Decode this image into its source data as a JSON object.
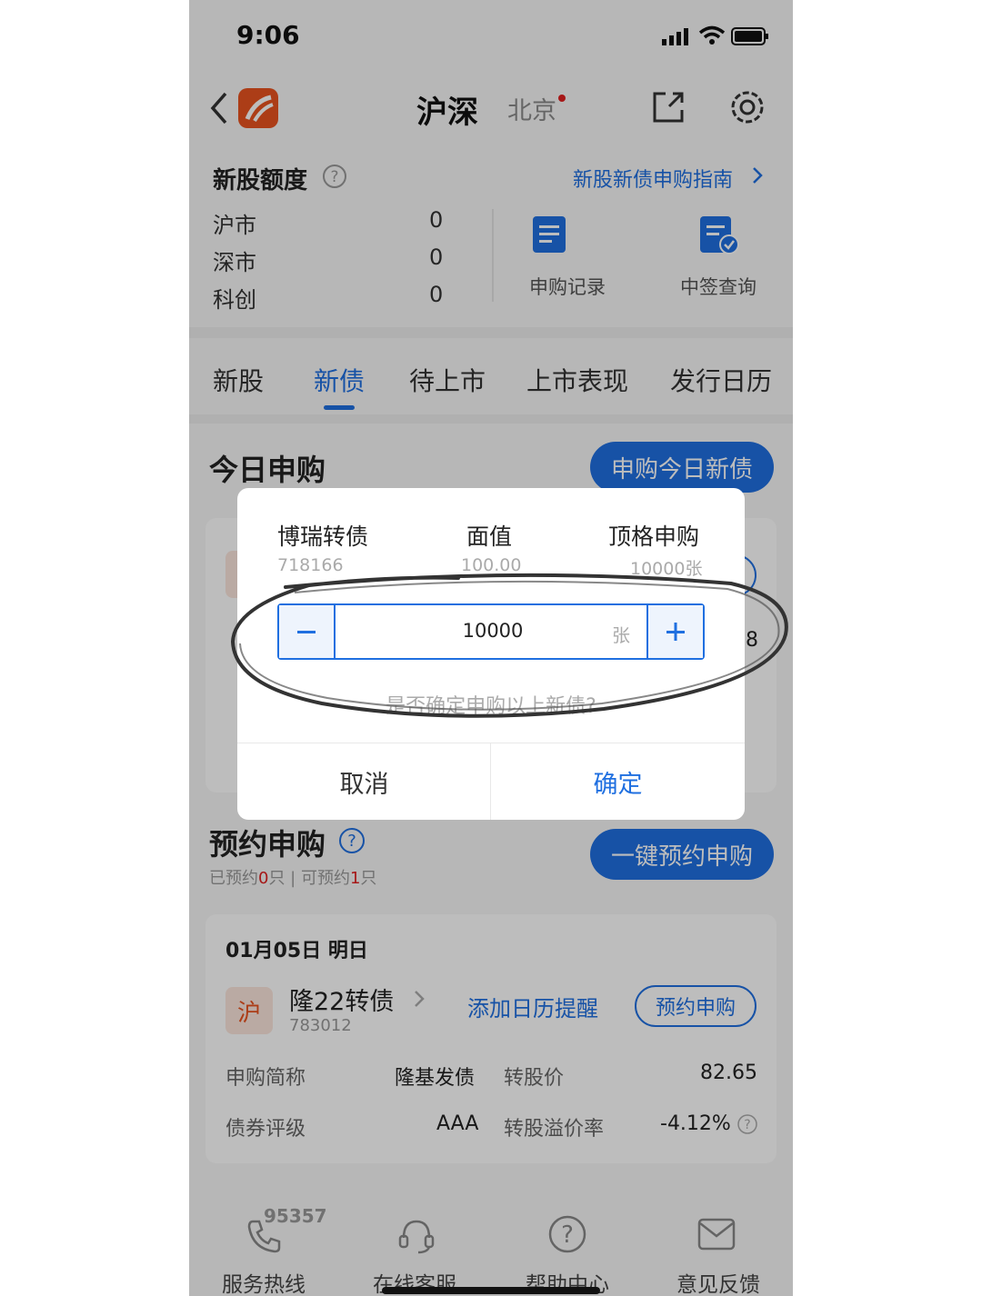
{
  "status_bar": {
    "time": "9:06"
  },
  "header": {
    "title": "沪深",
    "region": "北京"
  },
  "quota": {
    "title": "新股额度",
    "guide_link": "新股新债申购指南",
    "rows": [
      {
        "label": "沪市",
        "value": "0"
      },
      {
        "label": "深市",
        "value": "0"
      },
      {
        "label": "科创",
        "value": "0"
      }
    ],
    "tiles": [
      {
        "label": "申购记录"
      },
      {
        "label": "中签查询"
      }
    ]
  },
  "tabs": [
    "新股",
    "新债",
    "待上市",
    "上市表现",
    "发行日历"
  ],
  "today": {
    "title": "今日申购",
    "action": "申购今日新债",
    "partial_value": "8"
  },
  "reserve": {
    "title": "预约申购",
    "summary_prefix": "已预约",
    "reserved_count": "0",
    "summary_mid": "只 | 可预约",
    "available_count": "1",
    "summary_suffix": "只",
    "action": "一键预约申购"
  },
  "reserve_card": {
    "date": "01月05日 明日",
    "market_badge": "沪",
    "bond_name": "隆22转债",
    "bond_code": "783012",
    "calendar_link": "添加日历提醒",
    "reserve_button": "预约申购",
    "fields": [
      {
        "label": "申购简称",
        "value": "隆基发债"
      },
      {
        "label": "转股价",
        "value": "82.65"
      },
      {
        "label": "债券评级",
        "value": "AAA"
      },
      {
        "label": "转股溢价率",
        "value": "-4.12%"
      }
    ]
  },
  "dialog": {
    "col1_title": "博瑞转债",
    "col1_sub": "718166",
    "col2_title": "面值",
    "col2_sub": "100.00",
    "col3_title": "顶格申购",
    "col3_sub": "10000张",
    "quantity": "10000",
    "unit": "张",
    "confirm_text": "是否确定申购以上新债?",
    "cancel": "取消",
    "ok": "确定"
  },
  "bottom_nav": {
    "hotline_number": "95357",
    "items": [
      "服务热线",
      "在线客服",
      "帮助中心",
      "意见反馈"
    ]
  },
  "colors": {
    "accent": "#1f6fe0",
    "brand": "#e8531f",
    "badge_bg": "#fbe6dc"
  }
}
